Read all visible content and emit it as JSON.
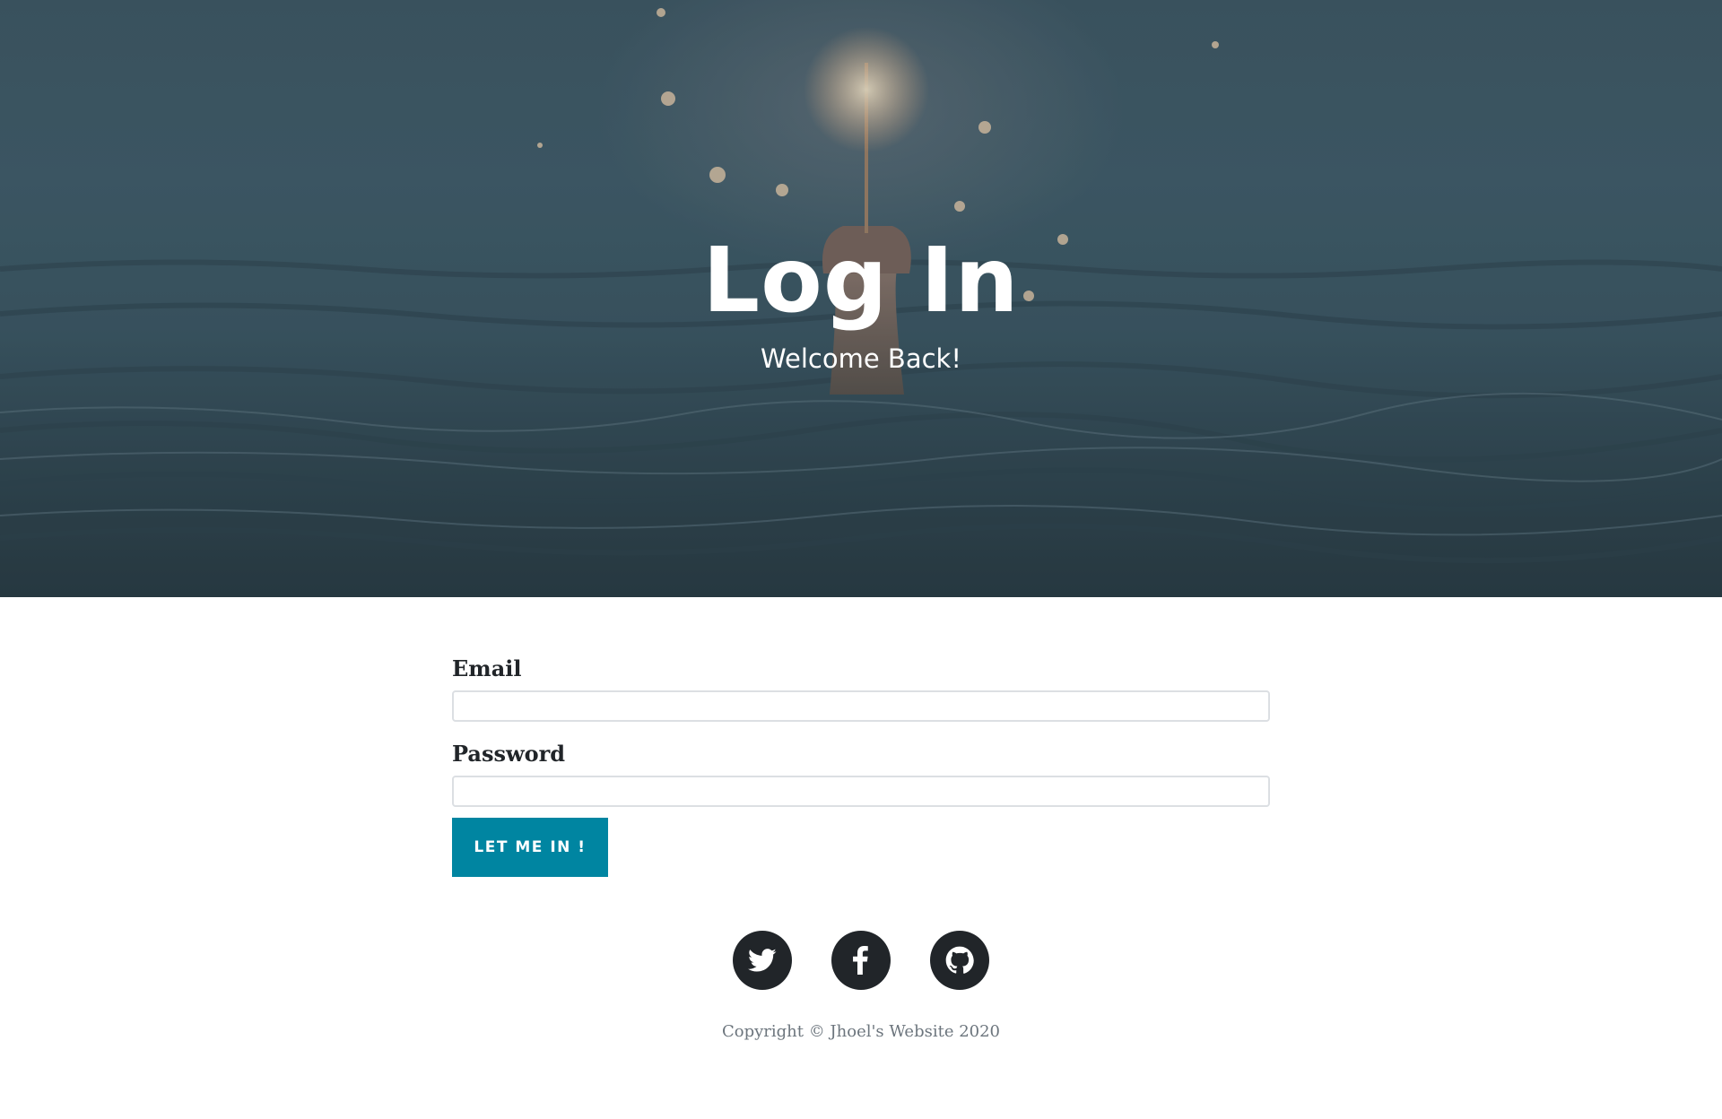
{
  "hero": {
    "title": "Log In",
    "subtitle": "Welcome Back!",
    "background_image": "sparkler-hand-in-water-photo"
  },
  "form": {
    "email_label": "Email",
    "email_value": "",
    "password_label": "Password",
    "password_value": "",
    "submit_label": "LET ME IN !"
  },
  "social": {
    "links": [
      {
        "icon": "twitter-icon"
      },
      {
        "icon": "facebook-icon"
      },
      {
        "icon": "github-icon"
      }
    ]
  },
  "footer": {
    "copyright": "Copyright © Jhoel's Website 2020"
  },
  "colors": {
    "accent": "#0085a1",
    "text_dark": "#212529",
    "muted": "#6c757d"
  }
}
